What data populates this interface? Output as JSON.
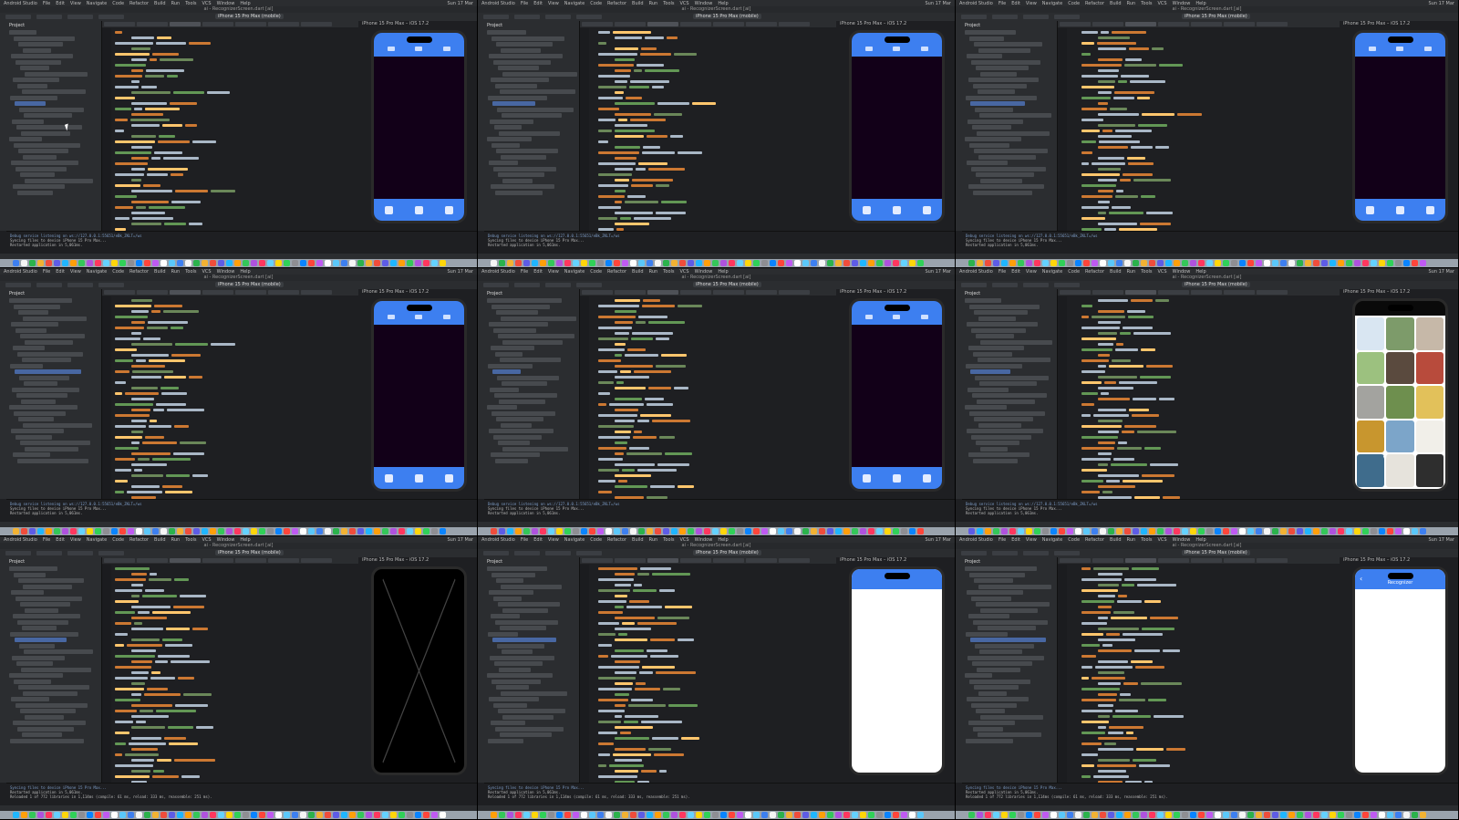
{
  "ide": {
    "menu_items": [
      "Android Studio",
      "File",
      "Edit",
      "View",
      "Navigate",
      "Code",
      "Refactor",
      "Build",
      "Run",
      "Tools",
      "VCS",
      "Window",
      "Help"
    ],
    "clock": "Sun 17 Mar",
    "window_title": "ai - RecognizerScreen.dart [ai]",
    "device_selector": "iPhone 15 Pro Max (mobile)",
    "project_label": "Project",
    "simulator_label": "iPhone 15 Pro Max – iOS 17.2",
    "console_lines": [
      "Debug service listening on ws://127.0.0.1:55651/eBk_ZKLT=/ws",
      "Syncing files to device iPhone 15 Pro Max...",
      "Restarted application in 5,061ms.",
      "Reloaded 1 of 772 libraries in 1,114ms (compile: 61 ms, reload: 333 ms, reassemble: 251 ms)."
    ],
    "appbar_title": "Recognizer"
  },
  "tiles": [
    {
      "phone": "dark"
    },
    {
      "phone": "dark"
    },
    {
      "phone": "dark"
    },
    {
      "phone": "dark"
    },
    {
      "phone": "dark"
    },
    {
      "phone": "gallery"
    },
    {
      "phone": "black"
    },
    {
      "phone": "white-blue"
    },
    {
      "phone": "white-title"
    }
  ],
  "colors": {
    "accent": "#3d7ff0",
    "app_dark": "#120018",
    "ide_bg": "#1e1f22"
  }
}
